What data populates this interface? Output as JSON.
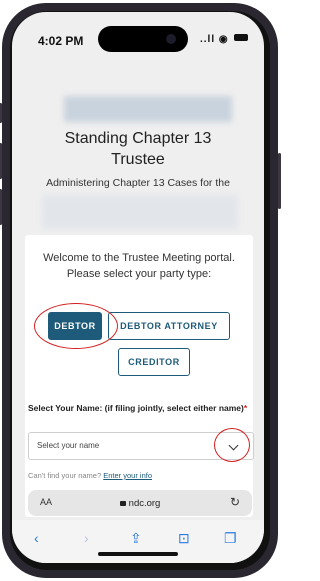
{
  "status_bar": {
    "time": "4:02 PM",
    "signal": "..ll",
    "wifi": "◉"
  },
  "page": {
    "title_line1": "Standing Chapter 13",
    "title_line2": "Trustee",
    "subtitle": "Administering Chapter 13 Cases for the"
  },
  "portal": {
    "welcome_line1": "Welcome to the Trustee Meeting portal.",
    "welcome_line2": "Please select your party type:",
    "party_types": [
      "DEBTOR",
      "DEBTOR ATTORNEY",
      "CREDITOR"
    ],
    "selected_party": "DEBTOR"
  },
  "name_select": {
    "label": "Select Your Name: (if filing jointly, select either name)",
    "required_marker": "*",
    "placeholder": "Select your name"
  },
  "help": {
    "text": "Can't find your name?",
    "link": "Enter your info"
  },
  "browser": {
    "aa_label": "AA",
    "url": "ndc.org"
  },
  "colors": {
    "accent": "#1e5a7a",
    "annotation": "#d31f1f"
  }
}
